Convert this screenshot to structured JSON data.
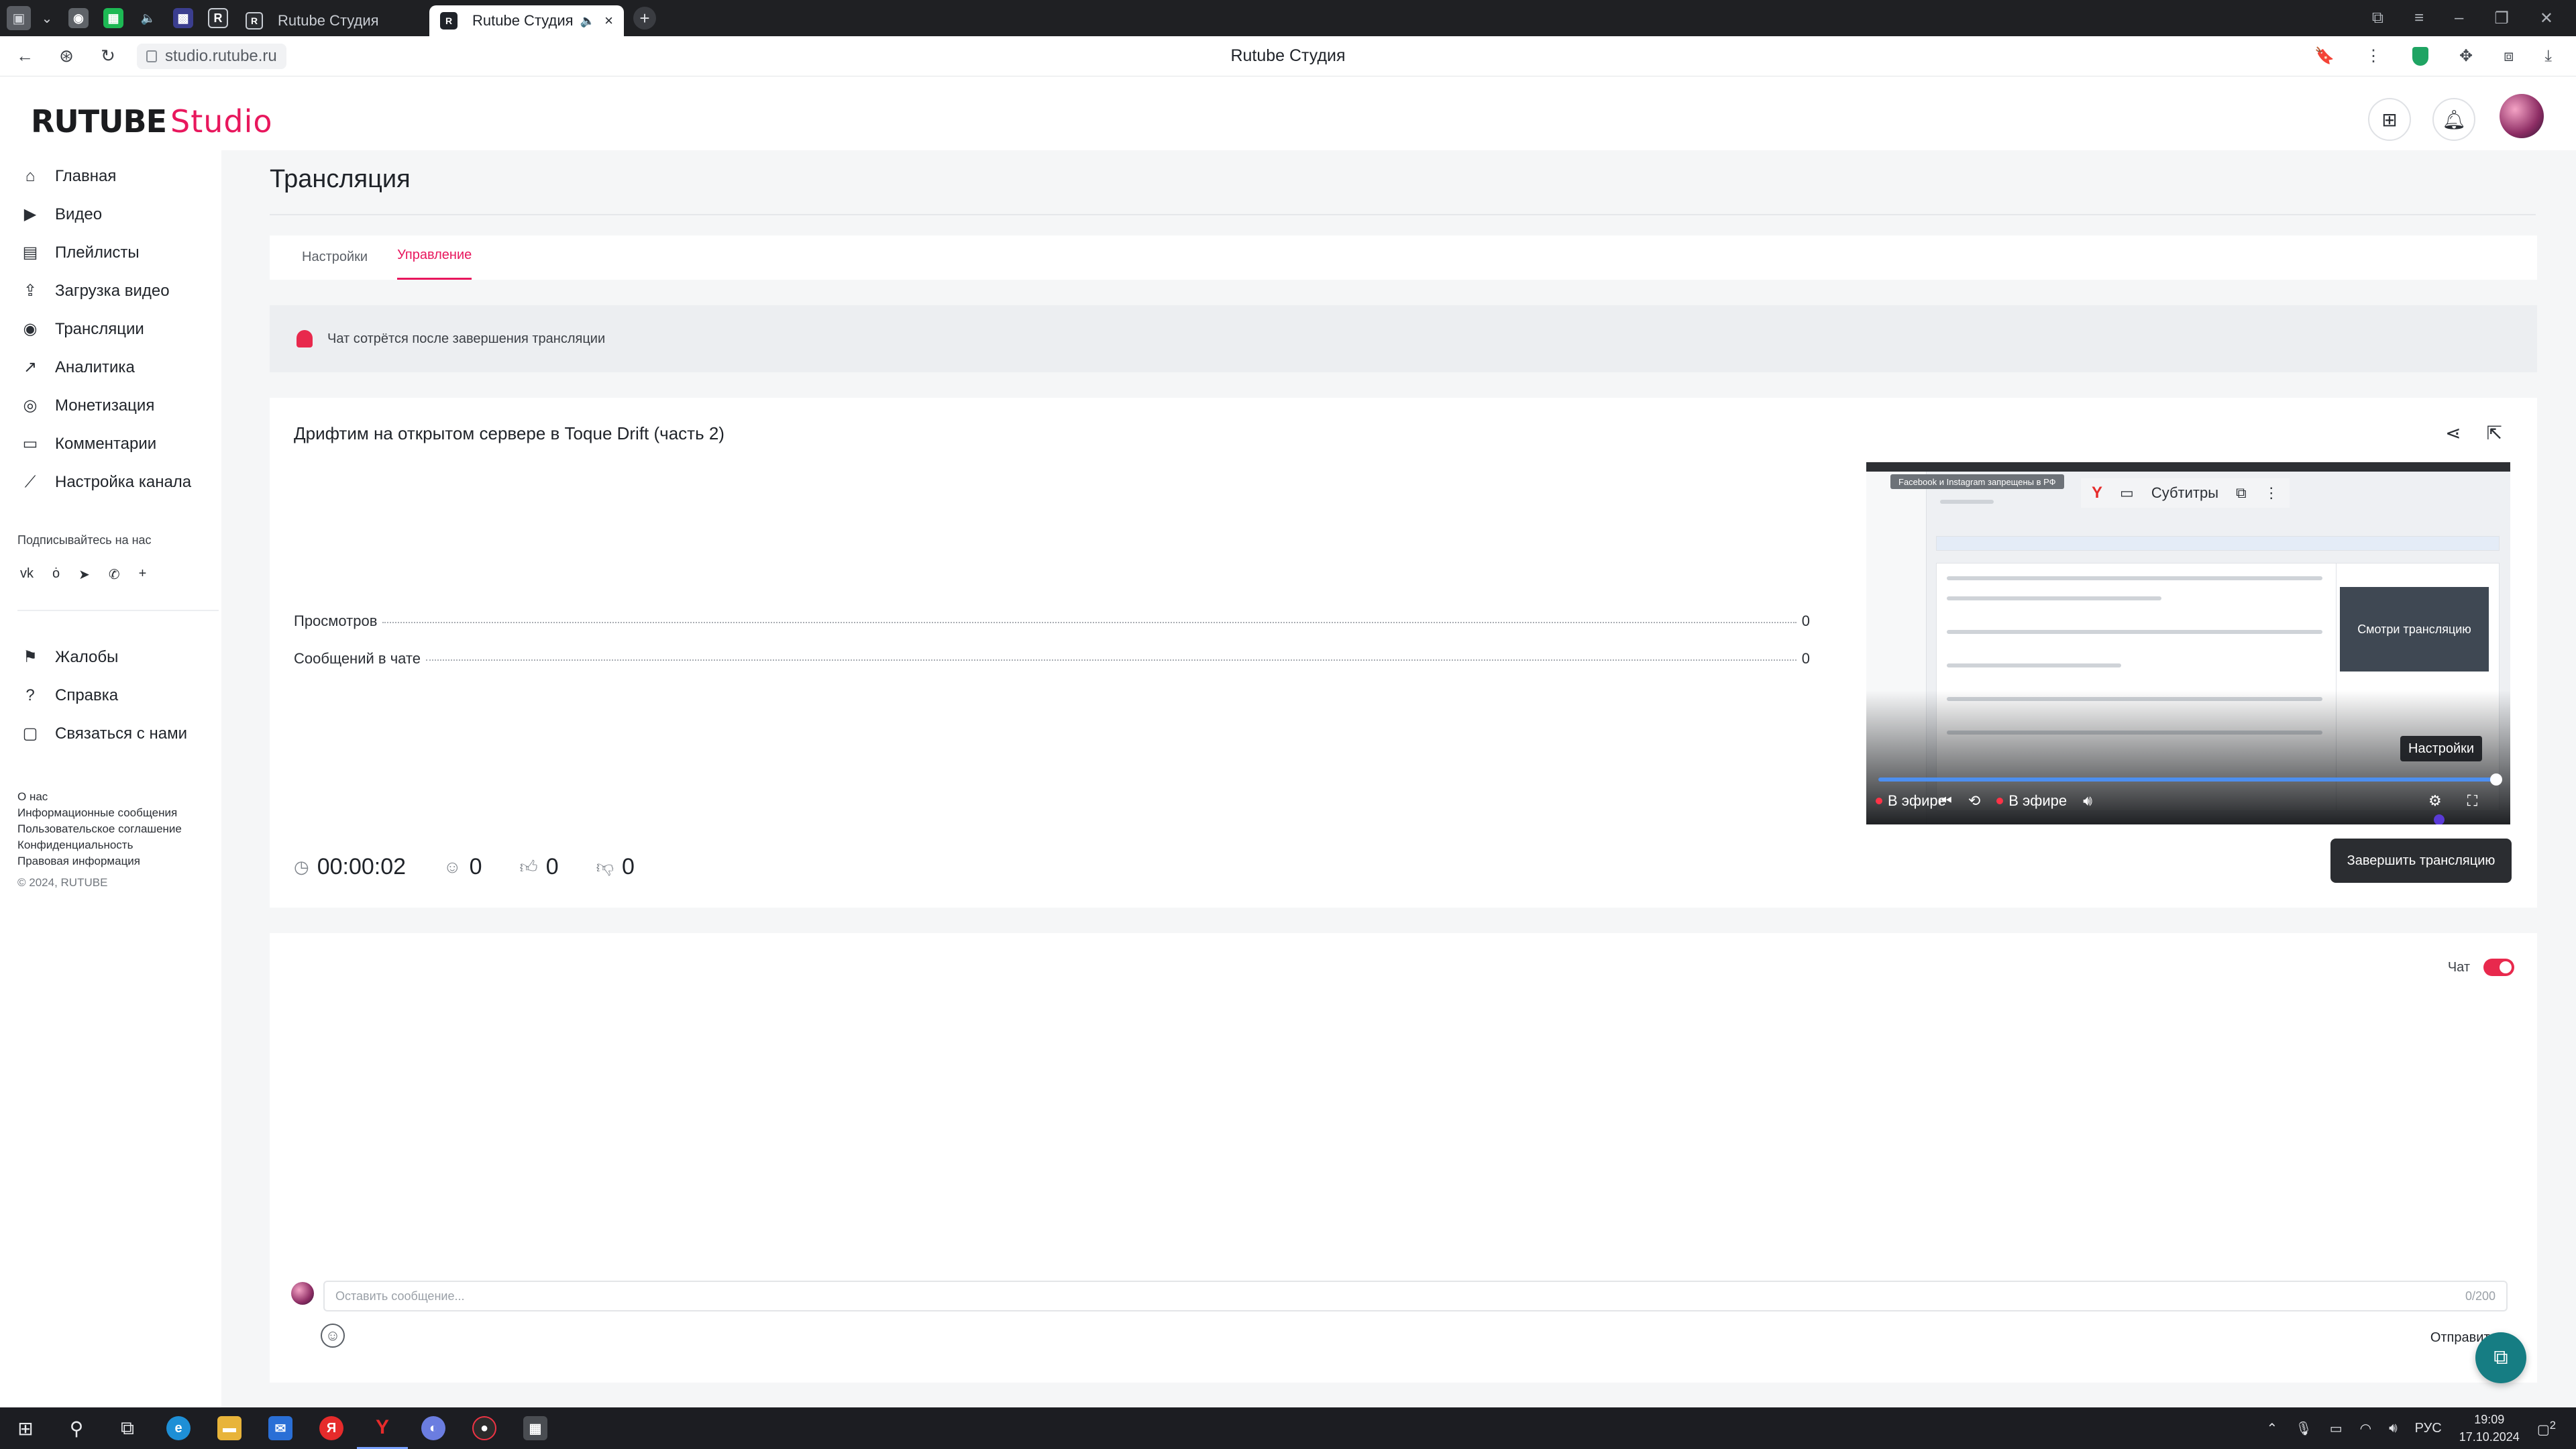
{
  "browser": {
    "tabs": [
      {
        "label": "Rutube Студия"
      },
      {
        "label": "Rutube Студия"
      }
    ],
    "url": "studio.rutube.ru",
    "page_title": "Rutube Студия"
  },
  "app": {
    "logo_main": "RUTUBE",
    "logo_accent": "Studio",
    "accent_color": "#e8175d"
  },
  "sidebar": {
    "items": [
      {
        "label": "Главная",
        "icon": "home-icon"
      },
      {
        "label": "Видео",
        "icon": "video-icon"
      },
      {
        "label": "Плейлисты",
        "icon": "playlist-icon"
      },
      {
        "label": "Загрузка видео",
        "icon": "upload-icon"
      },
      {
        "label": "Трансляции",
        "icon": "broadcast-icon"
      },
      {
        "label": "Аналитика",
        "icon": "analytics-icon"
      },
      {
        "label": "Монетизация",
        "icon": "coin-icon"
      },
      {
        "label": "Комментарии",
        "icon": "comments-icon"
      },
      {
        "label": "Настройка канала",
        "icon": "wand-icon"
      }
    ],
    "follow_title": "Подписывайтесь на нас",
    "help_items": [
      {
        "label": "Жалобы",
        "icon": "flag-icon"
      },
      {
        "label": "Справка",
        "icon": "question-icon"
      },
      {
        "label": "Связаться с нами",
        "icon": "chat-icon"
      }
    ],
    "footer": {
      "about": "О нас",
      "info": "Информационные сообщения",
      "terms": "Пользовательское соглашение",
      "privacy": "Конфиденциальность",
      "legal": "Правовая информация",
      "copyright": "© 2024, RUTUBE"
    }
  },
  "page": {
    "title": "Трансляция",
    "tabs": [
      {
        "label": "Настройки"
      },
      {
        "label": "Управление"
      }
    ],
    "notice": "Чат сотрётся после завершения трансляции"
  },
  "stream": {
    "title": "Дрифтим на открытом сервере в Toque Drift (часть 2)",
    "stats": [
      {
        "label": "Просмотров",
        "value": "0"
      },
      {
        "label": "Сообщений в чате",
        "value": "0"
      }
    ],
    "duration": "00:00:02",
    "viewers": "0",
    "likes": "0",
    "dislikes": "0",
    "end_button": "Завершить трансляцию"
  },
  "player": {
    "inner_label": "Facebook и Instagram запрещены в РФ",
    "subtitles_label": "Субтитры",
    "promo": "Смотри трансляцию",
    "tooltip": "Настройки",
    "live_label_left": "В эфире",
    "live_label": "В эфире",
    "progress": 1.0
  },
  "chat": {
    "toggle_label": "Чат",
    "placeholder": "Оставить сообщение...",
    "counter": "0/200",
    "send": "Отправить"
  },
  "taskbar": {
    "lang": "РУС",
    "time": "19:09",
    "date": "17.10.2024",
    "notifications": "2"
  }
}
